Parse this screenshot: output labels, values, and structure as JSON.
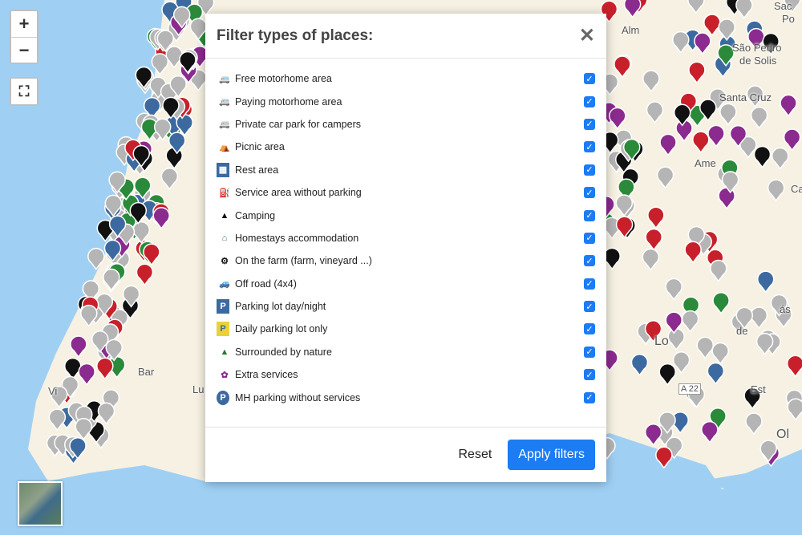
{
  "map": {
    "labels": [
      "Alm",
      "São Pedro",
      "de Solis",
      "Santa Cruz",
      "Sac",
      "Po",
      "Ame",
      "Ca",
      "Lo",
      "Bar",
      "Vi",
      "Lu",
      "Est",
      "Ol",
      "A 22",
      "de",
      "ás"
    ],
    "colors": {
      "sea": "#9fd0f4",
      "land": "#f6f1e3",
      "grey_pin": "#b5b5b5",
      "purple_pin": "#8b2a8f",
      "blue_pin": "#3c6aa0",
      "red_pin": "#c8202a",
      "green_pin": "#2a8a3a",
      "black_pin": "#111111"
    }
  },
  "controls": {
    "zoom_in": "+",
    "zoom_out": "−",
    "fullscreen": "⛶"
  },
  "modal": {
    "title": "Filter types of places:",
    "close": "✕",
    "items": [
      {
        "label": "Free motorhome area",
        "icon": "motorhome-green-icon",
        "color": "#2a7a32",
        "checked": true
      },
      {
        "label": "Paying motorhome area",
        "icon": "motorhome-red-icon",
        "color": "#d0282e",
        "checked": true
      },
      {
        "label": "Private car park for campers",
        "icon": "motorhome-blue-icon",
        "color": "#3c6aa0",
        "checked": true
      },
      {
        "label": "Picnic area",
        "icon": "picnic-tree-icon",
        "color": "#111111",
        "checked": true
      },
      {
        "label": "Rest area",
        "icon": "rest-area-icon",
        "color": "#3c6aa0",
        "checked": true
      },
      {
        "label": "Service area without parking",
        "icon": "service-area-icon",
        "color": "#111111",
        "checked": true
      },
      {
        "label": "Camping",
        "icon": "tent-icon",
        "color": "#111111",
        "checked": true
      },
      {
        "label": "Homestays accommodation",
        "icon": "homestay-icon",
        "color": "#3c6aa0",
        "checked": true
      },
      {
        "label": "On the farm (farm, vineyard ...)",
        "icon": "tractor-icon",
        "color": "#111111",
        "checked": true
      },
      {
        "label": "Off road (4x4)",
        "icon": "offroad-icon",
        "color": "#f0a820",
        "checked": true
      },
      {
        "label": "Parking lot day/night",
        "icon": "parking-icon",
        "color": "#3c6aa0",
        "checked": true
      },
      {
        "label": "Daily parking lot only",
        "icon": "daily-parking-icon",
        "color": "#e8d23a",
        "checked": true
      },
      {
        "label": "Surrounded by nature",
        "icon": "pine-tree-icon",
        "color": "#2a7a32",
        "checked": true
      },
      {
        "label": "Extra services",
        "icon": "extra-services-icon",
        "color": "#8b2a8f",
        "checked": true
      },
      {
        "label": "MH parking without services",
        "icon": "mh-parking-icon",
        "color": "#3c6aa0",
        "checked": true
      }
    ],
    "reset": "Reset",
    "apply": "Apply filters"
  }
}
